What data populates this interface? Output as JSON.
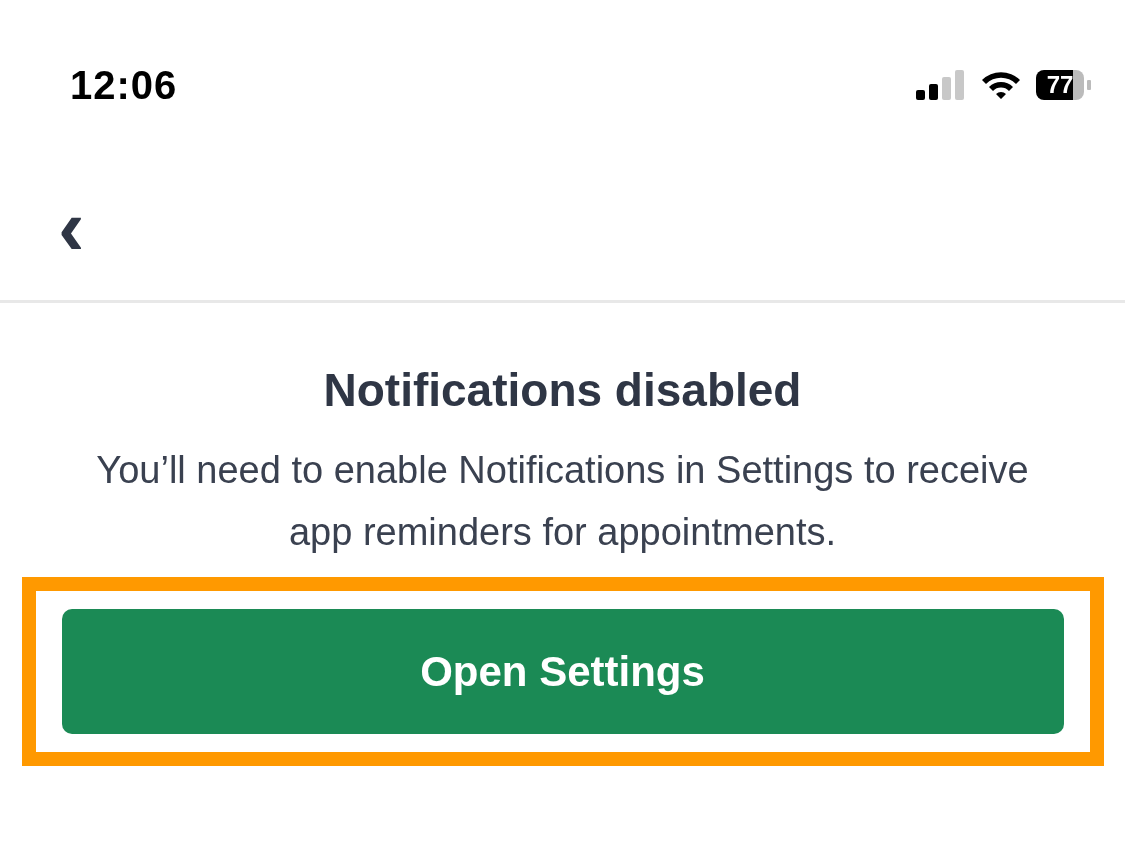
{
  "status_bar": {
    "time": "12:06",
    "battery": "77"
  },
  "header": {
    "back": "‹"
  },
  "title": "Notifications disabled",
  "message": "You’ll need to enable Notifications in Settings to receive app reminders for appointments.",
  "button": {
    "label": "Open Settings",
    "highlighted": true
  }
}
